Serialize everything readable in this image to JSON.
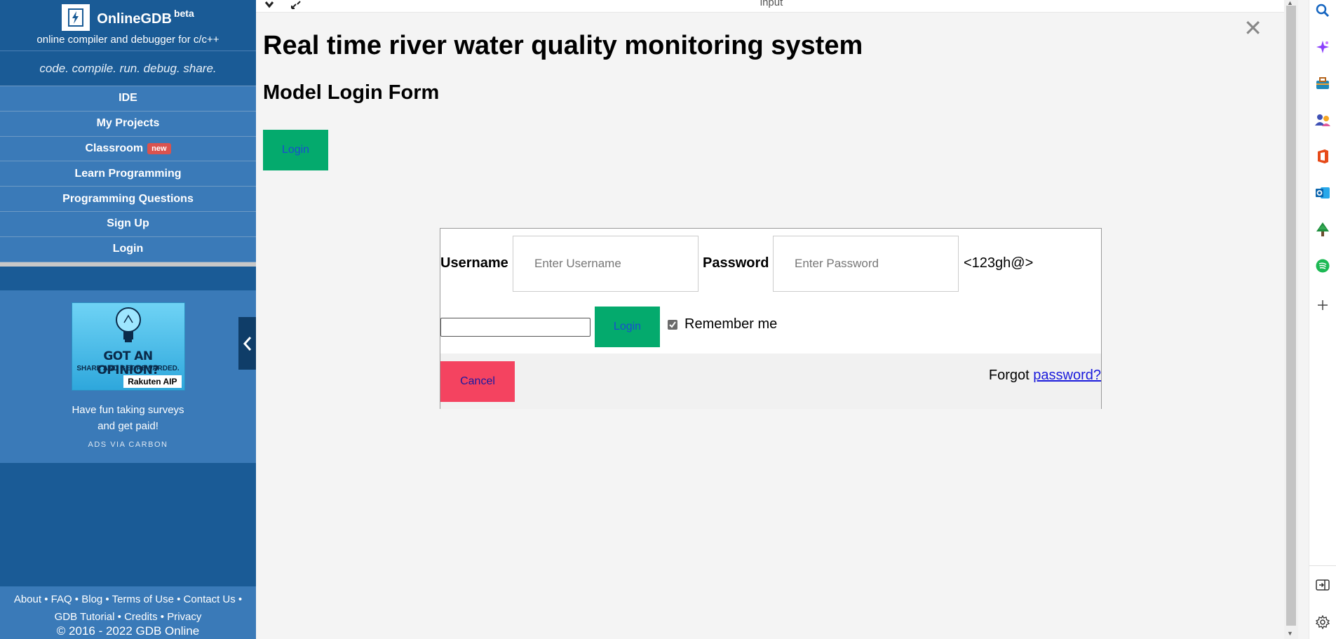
{
  "sidebar": {
    "brand_name": "OnlineGDB",
    "brand_tag": "beta",
    "brand_sub": "online compiler and debugger for c/c++",
    "tagline": "code. compile. run. debug. share.",
    "nav": [
      {
        "label": "IDE"
      },
      {
        "label": "My Projects"
      },
      {
        "label": "Classroom",
        "badge": "new"
      },
      {
        "label": "Learn Programming"
      },
      {
        "label": "Programming Questions"
      },
      {
        "label": "Sign Up"
      },
      {
        "label": "Login"
      }
    ],
    "ad": {
      "headline": "GOT AN OPINION?",
      "subline": "SHARE AND GET REWARDED.",
      "brand": "Rakuten AIP",
      "text_line1": "Have fun taking surveys",
      "text_line2": "and get paid!",
      "via": "ADS VIA CARBON"
    },
    "footer": {
      "links": [
        "About",
        "FAQ",
        "Blog",
        "Terms of Use",
        "Contact Us",
        "GDB Tutorial",
        "Credits",
        "Privacy"
      ],
      "copyright": "© 2016 - 2022 GDB Online"
    }
  },
  "main": {
    "topbar_title": "input",
    "page_title": "Real time river water quality monitoring system",
    "form_title": "Model Login Form",
    "open_login_label": "Login",
    "modal": {
      "username_label": "Username",
      "username_placeholder": "Enter Username",
      "password_label": "Password",
      "password_placeholder": "Enter Password",
      "password_hint": "<123gh@>",
      "login_label": "Login",
      "remember_label": "Remember me",
      "remember_checked": true,
      "cancel_label": "Cancel",
      "forgot_text": "Forgot",
      "forgot_link": "password?"
    }
  },
  "edgebar": {
    "icons": [
      "search-icon",
      "copilot-icon",
      "toolbox-icon",
      "people-icon",
      "office-icon",
      "outlook-icon",
      "tree-icon",
      "spotify-icon",
      "add-icon",
      "split-screen-icon",
      "settings-icon"
    ]
  },
  "colors": {
    "sidebar": "#1a5b96",
    "nav_item": "#3a7ab8",
    "login_button": "#04aa6d",
    "cancel_button": "#f44360"
  }
}
